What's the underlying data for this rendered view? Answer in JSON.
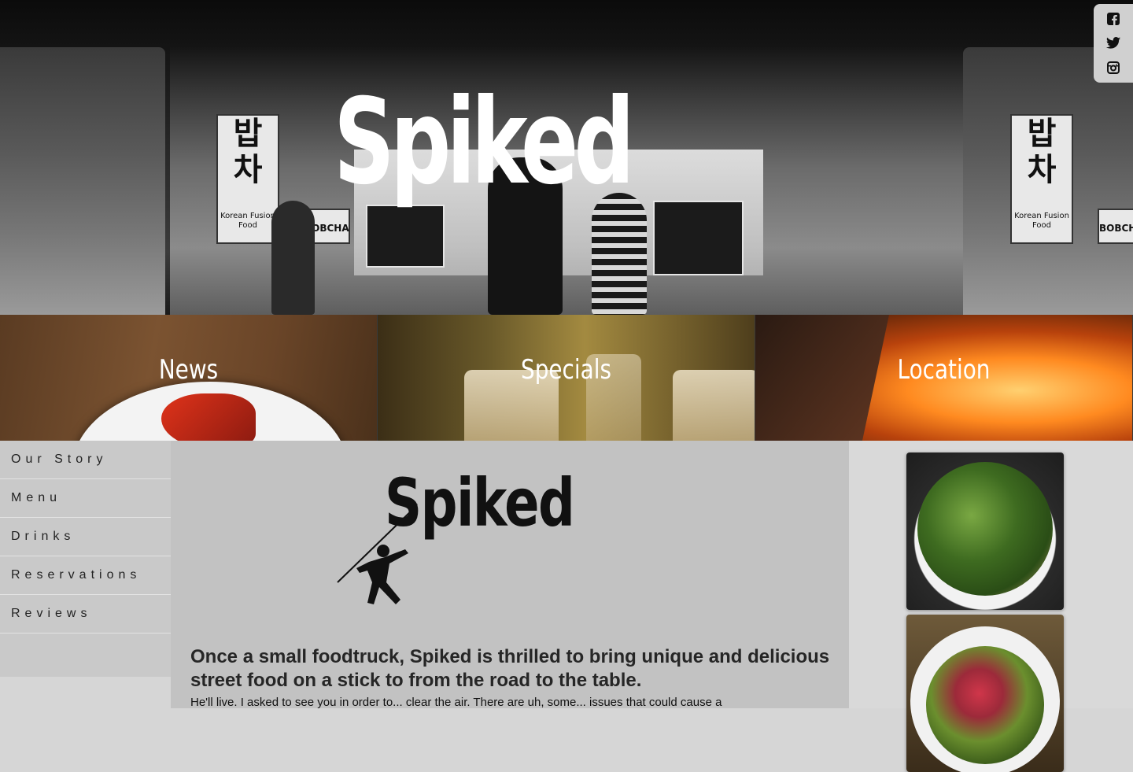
{
  "hero": {
    "title": "Spiked",
    "sign_korean": "밥 차",
    "sign_english": "Korean Fusion Food",
    "truck_name": "BOBCHA"
  },
  "social": {
    "icons": [
      "facebook-icon",
      "twitter-icon",
      "instagram-icon"
    ]
  },
  "tiles": [
    {
      "label": "News"
    },
    {
      "label": "Specials"
    },
    {
      "label": "Location"
    }
  ],
  "sidebar": {
    "items": [
      {
        "label": "Our Story"
      },
      {
        "label": "Menu"
      },
      {
        "label": "Drinks"
      },
      {
        "label": "Reservations"
      },
      {
        "label": "Reviews"
      }
    ]
  },
  "main": {
    "logo_text": "Spiked",
    "tagline": "Once a small foodtruck, Spiked is thrilled to bring unique and delicious street food on a stick to from the road to the table.",
    "body": "He'll live. I asked to see you in order to... clear the air. There are uh, some... issues that could cause a"
  },
  "colors": {
    "page_bg": "#d6d6d6",
    "main_bg": "#c2c2c2",
    "sidebar_bg": "#c9c9c9",
    "text": "#262626"
  }
}
